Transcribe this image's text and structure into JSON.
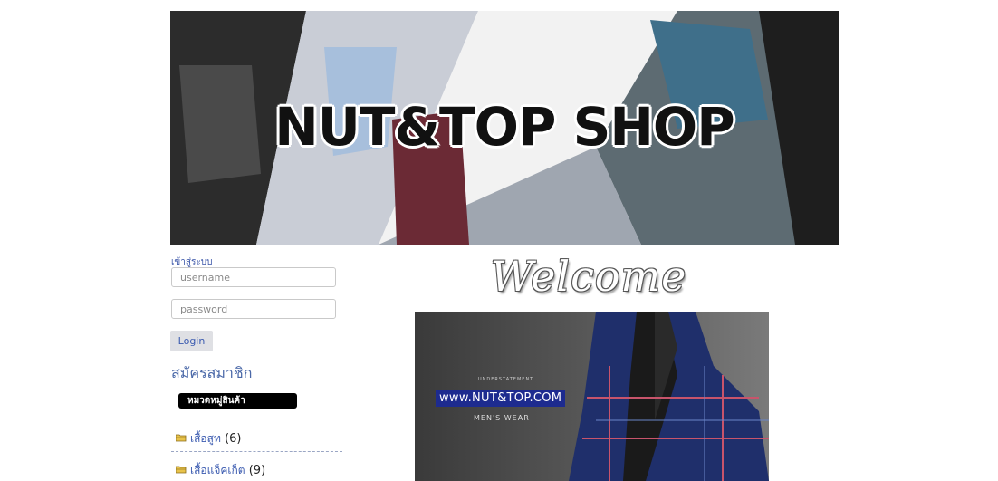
{
  "banner": {
    "title": "NUT&TOP SHOP"
  },
  "login": {
    "label": "เข้าสู่ระบบ",
    "username_placeholder": "username",
    "password_placeholder": "password",
    "button": "Login",
    "register": "สมัครสมาชิก"
  },
  "categories": {
    "header": "หมวดหมู่สินค้า",
    "items": [
      {
        "name": "เสื้อสูท",
        "count": "(6)"
      },
      {
        "name": "เสื้อแจ็คเก็ต",
        "count": "(9)"
      }
    ]
  },
  "main": {
    "welcome": "Welcome",
    "promo_small": "UNDERSTATEMENT",
    "promo_url": "www.NUT&TOP.COM",
    "promo_sub": "MEN'S WEAR"
  },
  "colors": {
    "link": "#3b5bb0",
    "promo_url_bg": "#1d2b8f",
    "category_header_bg": "#000000"
  },
  "icons": {
    "category_item": "folder-icon"
  }
}
